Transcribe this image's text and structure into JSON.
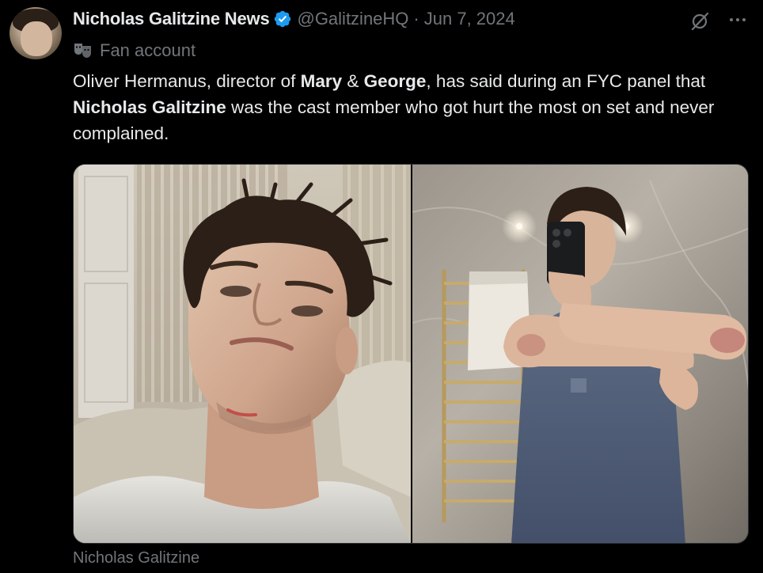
{
  "author": {
    "display_name": "Nicholas Galitzine News",
    "handle": "@GalitzineHQ",
    "date": "Jun 7, 2024",
    "separator": "·",
    "label": "Fan account"
  },
  "icons": {
    "verified": "verified-badge-icon",
    "label": "theater-masks-icon",
    "grok": "grok-icon",
    "more": "more-options-icon"
  },
  "tweet": {
    "text_parts": [
      "Oliver Hermanus, director of ",
      "Mary",
      " & ",
      "George",
      ", has said during an FYC panel that ",
      "Nicholas Galitzine",
      " was the cast member who got hurt the most on set and never complained."
    ]
  },
  "media": {
    "images": [
      {
        "description": "close-up selfie with scratch on chin"
      },
      {
        "description": "mirror selfie showing bruised arms"
      }
    ],
    "tag_label": "Nicholas Galitzine"
  },
  "colors": {
    "background": "#000000",
    "text_primary": "#e7e9ea",
    "text_secondary": "#71767b",
    "verified_blue": "#1d9bf0"
  }
}
